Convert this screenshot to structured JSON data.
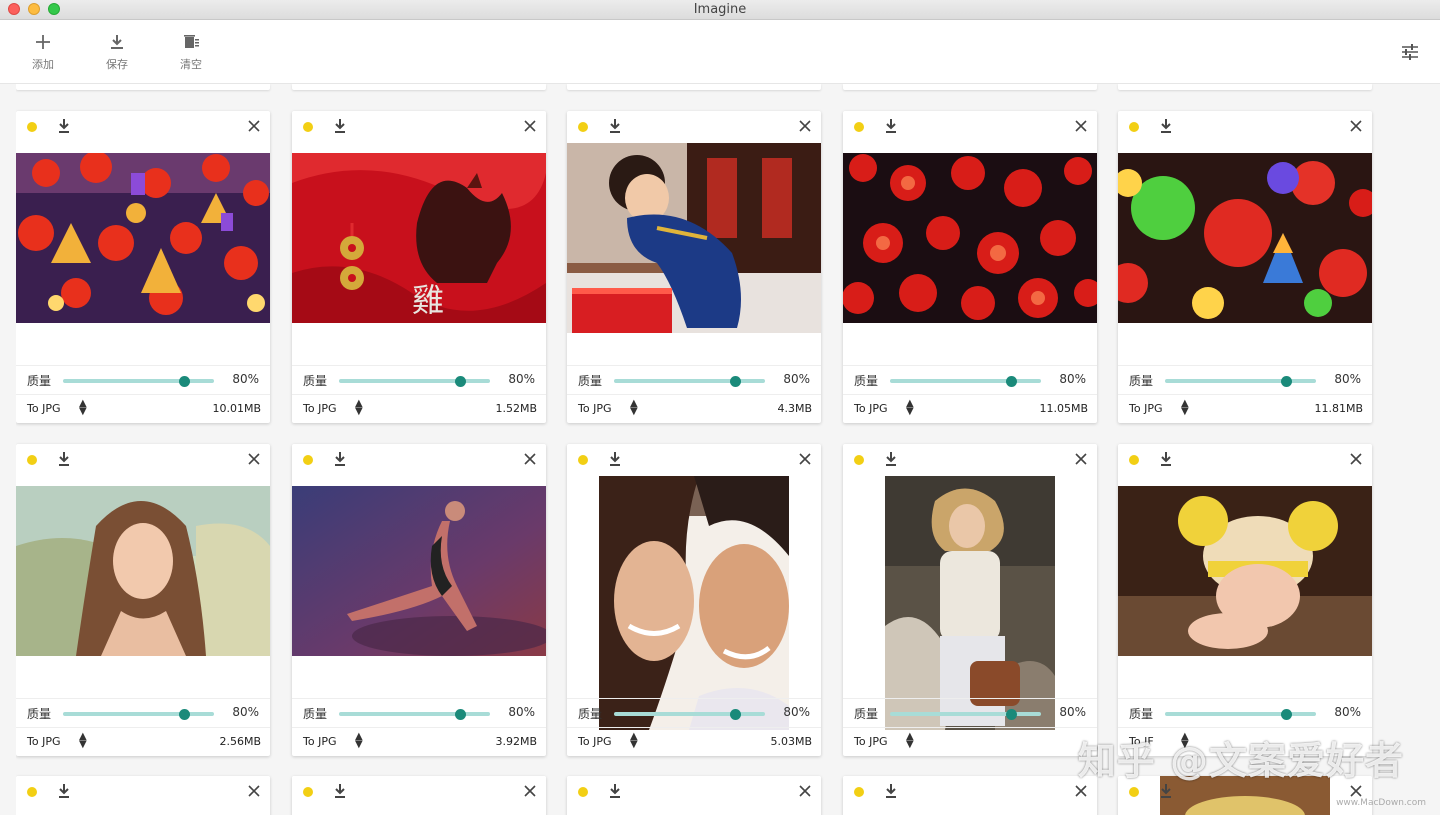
{
  "window": {
    "title": "Imagine"
  },
  "toolbar": {
    "add_label": "添加",
    "save_label": "保存",
    "clear_label": "清空"
  },
  "card_labels": {
    "quality": "质量"
  },
  "colors": {
    "accent": "#1a8a7a",
    "status_dot": "#f2cf14",
    "slider_track": "#a8dcd7"
  },
  "rows": [
    {
      "cards": [
        {
          "quality": "80%",
          "quality_value": 0.8,
          "format": "To JPG",
          "size": "10.01MB",
          "photo": "lanterns"
        },
        {
          "quality": "80%",
          "quality_value": 0.8,
          "format": "To JPG",
          "size": "1.52MB",
          "photo": "rooster"
        },
        {
          "quality": "80%",
          "quality_value": 0.8,
          "format": "To JPG",
          "size": "4.3MB",
          "photo": "baby-gift"
        },
        {
          "quality": "80%",
          "quality_value": 0.8,
          "format": "To JPG",
          "size": "11.05MB",
          "photo": "red-lanterns"
        },
        {
          "quality": "80%",
          "quality_value": 0.8,
          "format": "To JPG",
          "size": "11.81MB",
          "photo": "color-lanterns"
        }
      ]
    },
    {
      "cards": [
        {
          "quality": "80%",
          "quality_value": 0.8,
          "format": "To JPG",
          "size": "2.56MB",
          "photo": "woman-portrait"
        },
        {
          "quality": "80%",
          "quality_value": 0.8,
          "format": "To JPG",
          "size": "3.92MB",
          "photo": "dancer"
        },
        {
          "quality": "80%",
          "quality_value": 0.8,
          "format": "To JPG",
          "size": "5.03MB",
          "photo": "couple"
        },
        {
          "quality": "80%",
          "quality_value": 0.8,
          "format": "To JPG",
          "size": "",
          "photo": "woman-rocks"
        },
        {
          "quality": "80%",
          "quality_value": 0.8,
          "format": "To JF",
          "size": "",
          "photo": "baby-hat"
        }
      ]
    }
  ],
  "watermark": "知乎 @文案爱好者",
  "watermark_small": "www.MacDown.com"
}
